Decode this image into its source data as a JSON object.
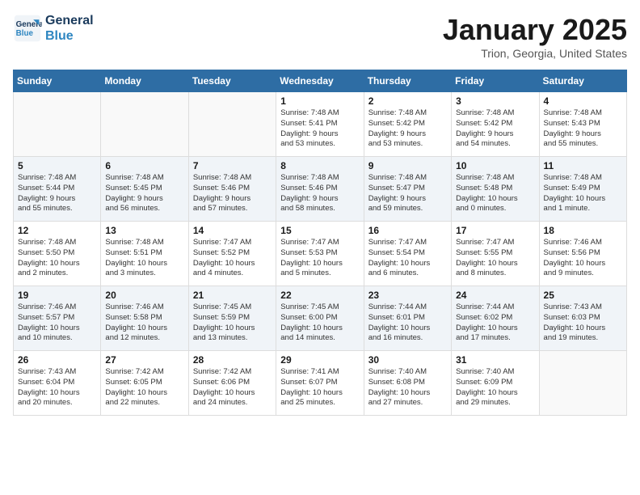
{
  "header": {
    "logo_line1": "General",
    "logo_line2": "Blue",
    "title": "January 2025",
    "subtitle": "Trion, Georgia, United States"
  },
  "days_of_week": [
    "Sunday",
    "Monday",
    "Tuesday",
    "Wednesday",
    "Thursday",
    "Friday",
    "Saturday"
  ],
  "weeks": [
    [
      {
        "day": "",
        "info": ""
      },
      {
        "day": "",
        "info": ""
      },
      {
        "day": "",
        "info": ""
      },
      {
        "day": "1",
        "info": "Sunrise: 7:48 AM\nSunset: 5:41 PM\nDaylight: 9 hours\nand 53 minutes."
      },
      {
        "day": "2",
        "info": "Sunrise: 7:48 AM\nSunset: 5:42 PM\nDaylight: 9 hours\nand 53 minutes."
      },
      {
        "day": "3",
        "info": "Sunrise: 7:48 AM\nSunset: 5:42 PM\nDaylight: 9 hours\nand 54 minutes."
      },
      {
        "day": "4",
        "info": "Sunrise: 7:48 AM\nSunset: 5:43 PM\nDaylight: 9 hours\nand 55 minutes."
      }
    ],
    [
      {
        "day": "5",
        "info": "Sunrise: 7:48 AM\nSunset: 5:44 PM\nDaylight: 9 hours\nand 55 minutes."
      },
      {
        "day": "6",
        "info": "Sunrise: 7:48 AM\nSunset: 5:45 PM\nDaylight: 9 hours\nand 56 minutes."
      },
      {
        "day": "7",
        "info": "Sunrise: 7:48 AM\nSunset: 5:46 PM\nDaylight: 9 hours\nand 57 minutes."
      },
      {
        "day": "8",
        "info": "Sunrise: 7:48 AM\nSunset: 5:46 PM\nDaylight: 9 hours\nand 58 minutes."
      },
      {
        "day": "9",
        "info": "Sunrise: 7:48 AM\nSunset: 5:47 PM\nDaylight: 9 hours\nand 59 minutes."
      },
      {
        "day": "10",
        "info": "Sunrise: 7:48 AM\nSunset: 5:48 PM\nDaylight: 10 hours\nand 0 minutes."
      },
      {
        "day": "11",
        "info": "Sunrise: 7:48 AM\nSunset: 5:49 PM\nDaylight: 10 hours\nand 1 minute."
      }
    ],
    [
      {
        "day": "12",
        "info": "Sunrise: 7:48 AM\nSunset: 5:50 PM\nDaylight: 10 hours\nand 2 minutes."
      },
      {
        "day": "13",
        "info": "Sunrise: 7:48 AM\nSunset: 5:51 PM\nDaylight: 10 hours\nand 3 minutes."
      },
      {
        "day": "14",
        "info": "Sunrise: 7:47 AM\nSunset: 5:52 PM\nDaylight: 10 hours\nand 4 minutes."
      },
      {
        "day": "15",
        "info": "Sunrise: 7:47 AM\nSunset: 5:53 PM\nDaylight: 10 hours\nand 5 minutes."
      },
      {
        "day": "16",
        "info": "Sunrise: 7:47 AM\nSunset: 5:54 PM\nDaylight: 10 hours\nand 6 minutes."
      },
      {
        "day": "17",
        "info": "Sunrise: 7:47 AM\nSunset: 5:55 PM\nDaylight: 10 hours\nand 8 minutes."
      },
      {
        "day": "18",
        "info": "Sunrise: 7:46 AM\nSunset: 5:56 PM\nDaylight: 10 hours\nand 9 minutes."
      }
    ],
    [
      {
        "day": "19",
        "info": "Sunrise: 7:46 AM\nSunset: 5:57 PM\nDaylight: 10 hours\nand 10 minutes."
      },
      {
        "day": "20",
        "info": "Sunrise: 7:46 AM\nSunset: 5:58 PM\nDaylight: 10 hours\nand 12 minutes."
      },
      {
        "day": "21",
        "info": "Sunrise: 7:45 AM\nSunset: 5:59 PM\nDaylight: 10 hours\nand 13 minutes."
      },
      {
        "day": "22",
        "info": "Sunrise: 7:45 AM\nSunset: 6:00 PM\nDaylight: 10 hours\nand 14 minutes."
      },
      {
        "day": "23",
        "info": "Sunrise: 7:44 AM\nSunset: 6:01 PM\nDaylight: 10 hours\nand 16 minutes."
      },
      {
        "day": "24",
        "info": "Sunrise: 7:44 AM\nSunset: 6:02 PM\nDaylight: 10 hours\nand 17 minutes."
      },
      {
        "day": "25",
        "info": "Sunrise: 7:43 AM\nSunset: 6:03 PM\nDaylight: 10 hours\nand 19 minutes."
      }
    ],
    [
      {
        "day": "26",
        "info": "Sunrise: 7:43 AM\nSunset: 6:04 PM\nDaylight: 10 hours\nand 20 minutes."
      },
      {
        "day": "27",
        "info": "Sunrise: 7:42 AM\nSunset: 6:05 PM\nDaylight: 10 hours\nand 22 minutes."
      },
      {
        "day": "28",
        "info": "Sunrise: 7:42 AM\nSunset: 6:06 PM\nDaylight: 10 hours\nand 24 minutes."
      },
      {
        "day": "29",
        "info": "Sunrise: 7:41 AM\nSunset: 6:07 PM\nDaylight: 10 hours\nand 25 minutes."
      },
      {
        "day": "30",
        "info": "Sunrise: 7:40 AM\nSunset: 6:08 PM\nDaylight: 10 hours\nand 27 minutes."
      },
      {
        "day": "31",
        "info": "Sunrise: 7:40 AM\nSunset: 6:09 PM\nDaylight: 10 hours\nand 29 minutes."
      },
      {
        "day": "",
        "info": ""
      }
    ]
  ]
}
